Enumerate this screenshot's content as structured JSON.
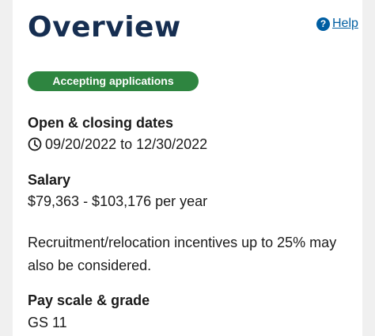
{
  "overview": {
    "title": "Overview",
    "help_label": "Help",
    "help_icon": "question-circle-icon",
    "status_badge": "Accepting applications",
    "colors": {
      "title": "#162e51",
      "link": "#005ea2",
      "badge_bg": "#2e8540"
    }
  },
  "dates": {
    "label": "Open & closing dates",
    "icon": "clock-icon",
    "value": "09/20/2022 to 12/30/2022"
  },
  "salary": {
    "label": "Salary",
    "value": "$79,363 - $103,176 per year"
  },
  "incentives": {
    "text": "Recruitment/relocation incentives up to 25% may also be considered."
  },
  "pay_scale": {
    "label": "Pay scale & grade",
    "value": "GS 11"
  }
}
